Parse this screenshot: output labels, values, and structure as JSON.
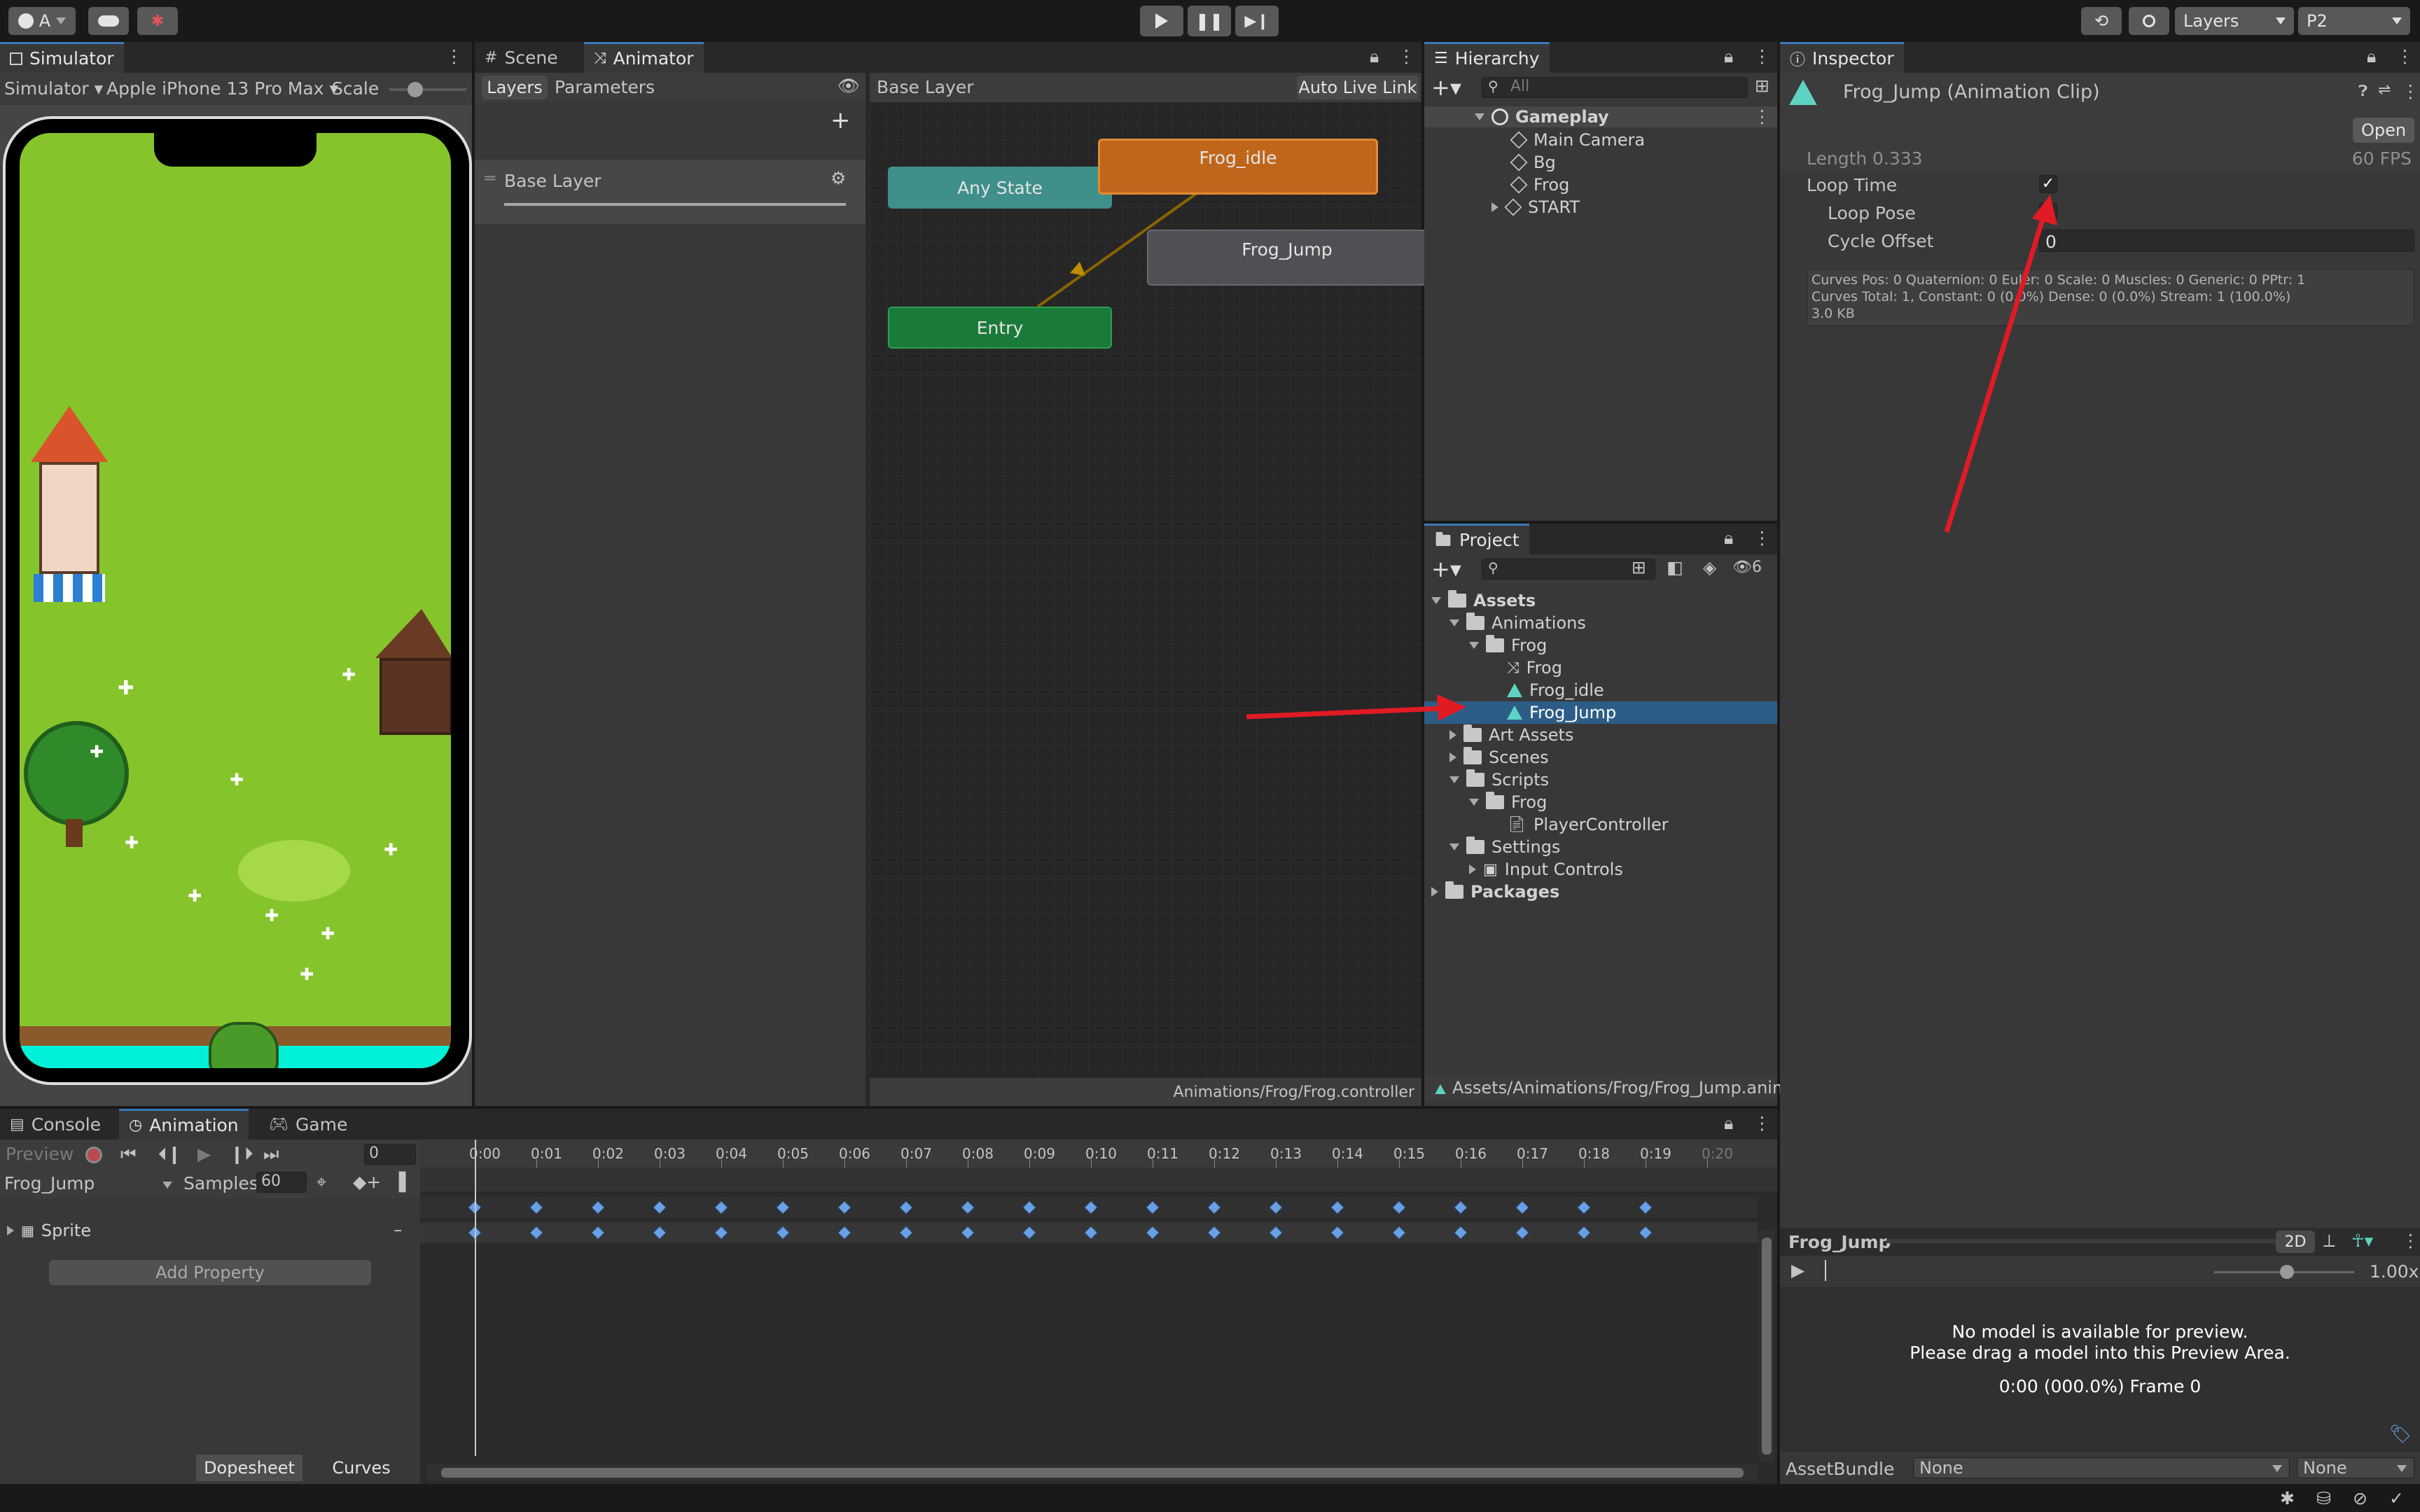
{
  "top": {
    "account": "A",
    "layers": "Layers",
    "layout": "P2"
  },
  "simulator": {
    "tab": "Simulator",
    "mode": "Simulator",
    "device": "Apple iPhone 13 Pro Max",
    "scale_label": "Scale"
  },
  "scene_tabs": {
    "scene": "Scene",
    "animator": "Animator"
  },
  "animator": {
    "layers_tab": "Layers",
    "parameters_tab": "Parameters",
    "breadcrumb": "Base Layer",
    "auto_live_link": "Auto Live Link",
    "layer_name": "Base Layer",
    "states": {
      "any": "Any State",
      "idle": "Frog_idle",
      "jump": "Frog_Jump",
      "entry": "Entry"
    },
    "footer_path": "Animations/Frog/Frog.controller",
    "colors": {
      "any": "#3f8f8a",
      "idle": "#c0661b",
      "jump": "#4f4f54",
      "entry": "#1a7a3a"
    }
  },
  "hierarchy": {
    "tab": "Hierarchy",
    "search": "All",
    "root": "Gameplay",
    "items": [
      "Main Camera",
      "Bg",
      "Frog",
      "START"
    ]
  },
  "project": {
    "tab": "Project",
    "hidden_count": "6",
    "tree": {
      "assets": "Assets",
      "animations": "Animations",
      "frog_folder": "Frog",
      "frog_controller": "Frog",
      "frog_idle": "Frog_idle",
      "frog_jump": "Frog_Jump",
      "art_assets": "Art Assets",
      "scenes": "Scenes",
      "scripts": "Scripts",
      "scripts_frog": "Frog",
      "player_controller": "PlayerController",
      "settings": "Settings",
      "input_controls": "Input Controls",
      "packages": "Packages"
    },
    "footer_path": "Assets/Animations/Frog/Frog_Jump.anim"
  },
  "inspector": {
    "tab": "Inspector",
    "title": "Frog_Jump (Animation Clip)",
    "open_button": "Open",
    "length_label": "Length",
    "length_value": "0.333",
    "fps": "60 FPS",
    "loop_time": "Loop Time",
    "loop_pose": "Loop Pose",
    "cycle_offset": "Cycle Offset",
    "cycle_offset_value": "0",
    "curves_line1": "Curves Pos: 0 Quaternion: 0 Euler: 0 Scale: 0 Muscles: 0 Generic: 0 PPtr: 1",
    "curves_line2": "Curves Total: 1, Constant: 0 (0.0%) Dense: 0 (0.0%) Stream: 1 (100.0%)",
    "size": "3.0 KB",
    "preview_title": "Frog_Jump",
    "preview_2d": "2D",
    "preview_speed": "1.00x",
    "no_model_1": "No model is available for preview.",
    "no_model_2": "Please drag a model into this Preview Area.",
    "frame_text": "0:00 (000.0%) Frame 0",
    "assetbundle_label": "AssetBundle",
    "assetbundle_value": "None",
    "variant_value": "None"
  },
  "bottom_tabs": {
    "console": "Console",
    "animation": "Animation",
    "game": "Game"
  },
  "animation": {
    "preview": "Preview",
    "frame": "0",
    "clip": "Frog_Jump",
    "samples_label": "Samples",
    "samples": "60",
    "property": "Sprite",
    "add_property": "Add Property",
    "dopesheet": "Dopesheet",
    "curves": "Curves",
    "ticks": [
      "0:00",
      "0:01",
      "0:02",
      "0:03",
      "0:04",
      "0:05",
      "0:06",
      "0:07",
      "0:08",
      "0:09",
      "0:10",
      "0:11",
      "0:12",
      "0:13",
      "0:14",
      "0:15",
      "0:16",
      "0:17",
      "0:18",
      "0:19",
      "0:20"
    ]
  }
}
